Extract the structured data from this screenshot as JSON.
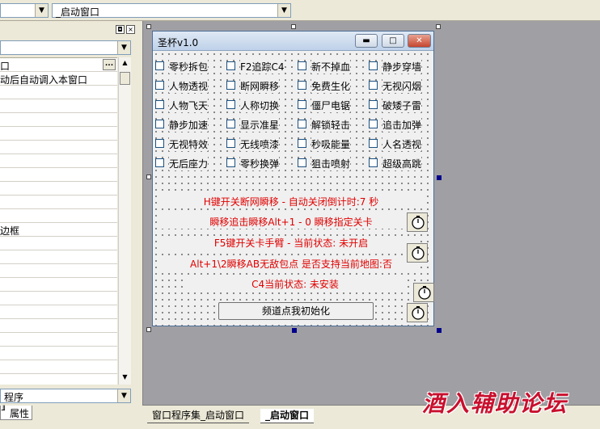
{
  "toolbar": {
    "left_combo_value": "",
    "right_combo_value": "_启动窗口"
  },
  "prop_panel": {
    "title_btn1": "◘",
    "title_btn2": "×",
    "ellipsis": "...",
    "rows": [
      {
        "text": "口"
      },
      {
        "text": "动后自动调入本窗口"
      },
      {
        "text": ""
      },
      {
        "text": ""
      },
      {
        "text": ""
      },
      {
        "text": ""
      },
      {
        "text": ""
      },
      {
        "text": ""
      },
      {
        "text": ""
      },
      {
        "text": ""
      },
      {
        "text": ""
      },
      {
        "text": ""
      },
      {
        "text": "边框"
      },
      {
        "text": ""
      },
      {
        "text": ""
      },
      {
        "text": ""
      },
      {
        "text": ""
      },
      {
        "text": ""
      },
      {
        "text": ""
      },
      {
        "text": ""
      },
      {
        "text": ""
      },
      {
        "text": ""
      },
      {
        "text": ""
      }
    ],
    "bottom_combo_value": "程序",
    "tab_label": "属性"
  },
  "window": {
    "title": "圣杯v1.0",
    "minimize_icon": "▬",
    "maximize_icon": "□",
    "close_icon": "✕"
  },
  "checkboxes": [
    [
      "零秒拆包",
      "F2追踪C4",
      "新不掉血",
      "静步穿墙"
    ],
    [
      "人物透视",
      "断网瞬移",
      "免费生化",
      "无视闪烟"
    ],
    [
      "人物飞天",
      "人称切换",
      "僵尸电锯",
      "破矮子雷"
    ],
    [
      "静步加速",
      "显示准星",
      "解锁轻击",
      "追击加弹"
    ],
    [
      "无视特效",
      "无线喷漆",
      "秒吸能量",
      "人名透视"
    ],
    [
      "无后座力",
      "零秒换弹",
      "狙击喷射",
      "超级高跳"
    ]
  ],
  "status_lines": {
    "line1": "H键开关断网瞬移 - 自动关闭倒计时:7 秒",
    "line2": "瞬移追击瞬移Alt+1 - 0 瞬移指定关卡",
    "line3": "F5键开关卡手臂 - 当前状态: 未开启",
    "line4": "Alt+1\\2瞬移AB无敌包点 是否支持当前地图:否",
    "line5": "C4当前状态: 未安装"
  },
  "init_button": "频道点我初始化",
  "tabs": {
    "tab1": "窗口程序集_启动窗口",
    "tab2": "_启动窗口"
  },
  "watermark": "酒入辅助论坛",
  "colors": {
    "status_red": "#e00000",
    "watermark_red": "#c8102e",
    "design_bg": "#a0a0a4"
  }
}
